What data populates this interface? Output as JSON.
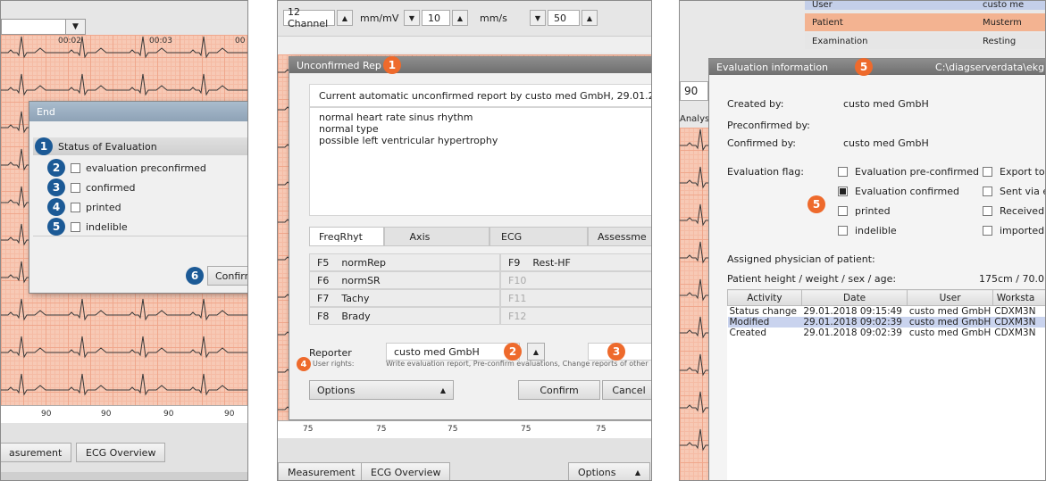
{
  "colors": {
    "badge_blue": "#1c5a96",
    "badge_orange": "#ee6a2c",
    "ecg_paper": "#f7c9b5",
    "ecg_trace": "#3a3a3a"
  },
  "panel1": {
    "combo_value": "",
    "time_labels": [
      "00:02",
      "00:03",
      "00"
    ],
    "dialog_title": "End",
    "status_header": "Status of Evaluation",
    "badge_status": "1",
    "options": [
      {
        "badge": "2",
        "label": "evaluation preconfirmed",
        "checked": false
      },
      {
        "badge": "3",
        "label": "confirmed",
        "checked": false
      },
      {
        "badge": "4",
        "label": "printed",
        "checked": false
      },
      {
        "badge": "5",
        "label": "indelible",
        "checked": false
      }
    ],
    "confirm_badge": "6",
    "confirm_label": "Confirm",
    "tick_labels": [
      "90",
      "90",
      "90",
      "90"
    ],
    "tabs": [
      "asurement",
      "ECG Overview"
    ]
  },
  "panel2": {
    "toolbar": {
      "channel": "12 Channel",
      "unit1": "mm/mV",
      "val1": "10",
      "unit2": "mm/s",
      "val2": "50"
    },
    "dialog_title": "Unconfirmed Rep",
    "badge_title": "1",
    "report_header": "Current automatic unconfirmed report by custo med GmbH, 29.01.20",
    "report_lines": [
      "normal heart rate sinus rhythm",
      "normal type",
      "possible left ventricular hypertrophy"
    ],
    "tabs": [
      "FreqRhyt",
      "Axis",
      "ECG",
      "Assessme"
    ],
    "shortcuts": [
      {
        "key": "F5",
        "name": "normRep"
      },
      {
        "key": "F9",
        "name": "Rest-HF"
      },
      {
        "key": "F6",
        "name": "normSR"
      },
      {
        "key": "F10",
        "name": ""
      },
      {
        "key": "F7",
        "name": "Tachy"
      },
      {
        "key": "F11",
        "name": ""
      },
      {
        "key": "F8",
        "name": "Brady"
      },
      {
        "key": "F12",
        "name": ""
      }
    ],
    "reporter_label": "Reporter",
    "reporter_value": "custo med GmbH",
    "badge_reporter": "2",
    "badge_second": "3",
    "badge_rights": "4",
    "user_rights_label": "User rights:",
    "user_rights_text": "Write evaluation report, Pre-confirm evaluations, Change reports of other",
    "options_label": "Options",
    "confirm_label": "Confirm",
    "cancel_label": "Cancel",
    "tick_labels": [
      "75",
      "75",
      "75",
      "75",
      "75"
    ],
    "bottom_tabs": [
      "Measurement",
      "ECG Overview"
    ],
    "bottom_options": "Options"
  },
  "panel3": {
    "top_rows": [
      "User",
      "Patient",
      "Examination"
    ],
    "top_rows_right": [
      "custo me",
      "Musterm",
      "Resting"
    ],
    "side_number": "90",
    "side_label": "Analys",
    "dialog_title": "Evaluation information",
    "badge_title": "5",
    "path": "C:\\diagserverdata\\ekg",
    "created_by_label": "Created by:",
    "created_by_value": "custo med GmbH",
    "preconfirmed_by_label": "Preconfirmed by:",
    "confirmed_by_label": "Confirmed by:",
    "confirmed_by_value": "custo med GmbH",
    "flag_label": "Evaluation flag:",
    "badge_flags": "5",
    "flags_left": [
      {
        "label": "Evaluation pre-confirmed",
        "checked": false
      },
      {
        "label": "Evaluation confirmed",
        "checked": true
      },
      {
        "label": "printed",
        "checked": false
      },
      {
        "label": "indelible",
        "checked": false
      }
    ],
    "flags_right": [
      {
        "label": "Export to",
        "checked": false
      },
      {
        "label": "Sent via e",
        "checked": false
      },
      {
        "label": "Received",
        "checked": false
      },
      {
        "label": "imported",
        "checked": false
      }
    ],
    "physician_label": "Assigned physician of patient:",
    "patient_label": "Patient height / weight / sex / age:",
    "patient_value": "175cm / 70.0k",
    "table_headers": [
      "Activity",
      "Date",
      "User",
      "Worksta"
    ],
    "table_rows": [
      [
        "Status change",
        "29.01.2018 09:15:49",
        "custo med GmbH",
        "CDXM3N"
      ],
      [
        "Modified",
        "29.01.2018 09:02:39",
        "custo med GmbH",
        "CDXM3N"
      ],
      [
        "Created",
        "29.01.2018 09:02:39",
        "custo med GmbH",
        "CDXM3N"
      ]
    ]
  }
}
